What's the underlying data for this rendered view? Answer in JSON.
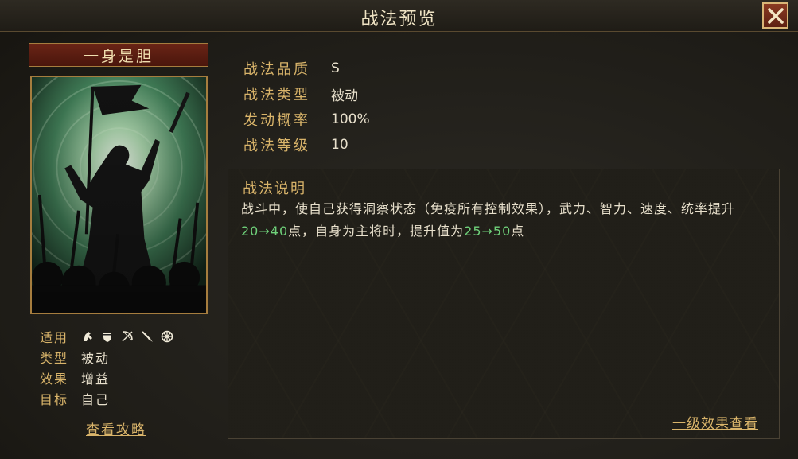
{
  "window": {
    "title": "战法预览"
  },
  "skill": {
    "name": "一身是胆",
    "applicable_label": "适用",
    "troop_icons": [
      "cavalry-icon",
      "shield-icon",
      "bow-icon",
      "spear-icon",
      "siege-wheel-icon"
    ],
    "type_label": "类型",
    "type_value": "被动",
    "effect_label": "效果",
    "effect_value": "增益",
    "target_label": "目标",
    "target_value": "自己",
    "guide_link": "查看攻略"
  },
  "stats": [
    {
      "label": "战法品质",
      "value": "S"
    },
    {
      "label": "战法类型",
      "value": "被动"
    },
    {
      "label": "发动概率",
      "value": "100%"
    },
    {
      "label": "战法等级",
      "value": "10"
    }
  ],
  "description": {
    "title": "战法说明",
    "part1": "战斗中，使自己获得洞察状态（免疫所有控制效果），武力、智力、速度、统率提升",
    "hl1": "20→40",
    "part2": "点，自身为主将时，提升值为",
    "hl2": "25→50",
    "part3": "点"
  },
  "level_link": "一级效果查看",
  "colors": {
    "accent": "#d9b46a",
    "highlight": "#6fd17a",
    "close_bg": "#7a2e1a"
  }
}
